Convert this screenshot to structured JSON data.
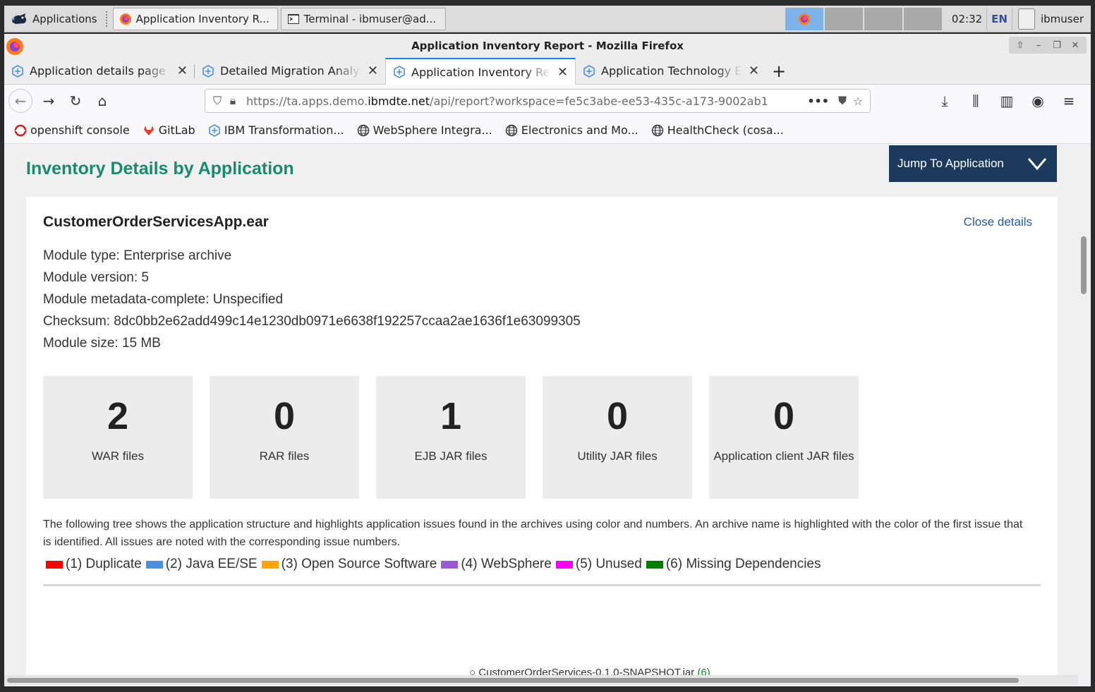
{
  "panel": {
    "apps_label": "Applications",
    "tasks": [
      {
        "label": "Application Inventory R...",
        "icon": "firefox-icon"
      },
      {
        "label": "Terminal - ibmuser@ad...",
        "icon": "terminal-icon"
      }
    ],
    "clock": "02:32",
    "lang": "EN",
    "user": "ibmuser"
  },
  "window": {
    "title": "Application Inventory Report - Mozilla Firefox"
  },
  "tabs": [
    {
      "label": "Application details page"
    },
    {
      "label": "Detailed Migration Analysis"
    },
    {
      "label": "Application Inventory Report"
    },
    {
      "label": "Application Technology Evaluation"
    }
  ],
  "url": {
    "prefix": "https://ta.apps.demo.",
    "domain": "ibmdte.net",
    "path": "/api/report?workspace=fe5c3abe-ee53-435c-a173-9002ab1"
  },
  "bookmarks": [
    {
      "label": "openshift console"
    },
    {
      "label": "GitLab"
    },
    {
      "label": "IBM Transformation..."
    },
    {
      "label": "WebSphere Integra..."
    },
    {
      "label": "Electronics and Mo..."
    },
    {
      "label": "HealthCheck (cosa..."
    }
  ],
  "page": {
    "title": "Inventory Details by Application",
    "jump_label": "Jump To Application",
    "app_name": "CustomerOrderServicesApp.ear",
    "close_details": "Close details",
    "meta": [
      "Module type: Enterprise archive",
      "Module version: 5",
      "Module metadata-complete: Unspecified",
      "Checksum: 8dc0bb2e62add499c14e1230db0971e6638f192257ccaa2ae1636f1e63099305",
      "Module size: 15 MB"
    ],
    "tiles": [
      {
        "num": "2",
        "label": "WAR files"
      },
      {
        "num": "0",
        "label": "RAR files"
      },
      {
        "num": "1",
        "label": "EJB JAR files"
      },
      {
        "num": "0",
        "label": "Utility JAR files"
      },
      {
        "num": "0",
        "label": "Application client JAR files"
      }
    ],
    "description": "The following tree shows the application structure and highlights application issues found in the archives using color and numbers. An archive name is highlighted with the color of the first issue that is identified. All issues are noted with the corresponding issue numbers.",
    "legend": [
      {
        "label": "(1) Duplicate",
        "color": "#ff0000"
      },
      {
        "label": "(2) Java EE/SE",
        "color": "#4a8fe0"
      },
      {
        "label": "(3) Open Source Software",
        "color": "#ffa500"
      },
      {
        "label": "(4) WebSphere",
        "color": "#9b59d6"
      },
      {
        "label": "(5) Unused",
        "color": "#ff00ff"
      },
      {
        "label": "(6) Missing Dependencies",
        "color": "#008000"
      }
    ],
    "tree_root": "CustomerOrderServices-0.1.0-SNAPSHOT.jar",
    "tree_root_count": "(6)"
  },
  "colors": {
    "title_green": "#1a8a6e",
    "jump_bg": "#1b3a5c",
    "tab_accent": "#0a84ff"
  }
}
